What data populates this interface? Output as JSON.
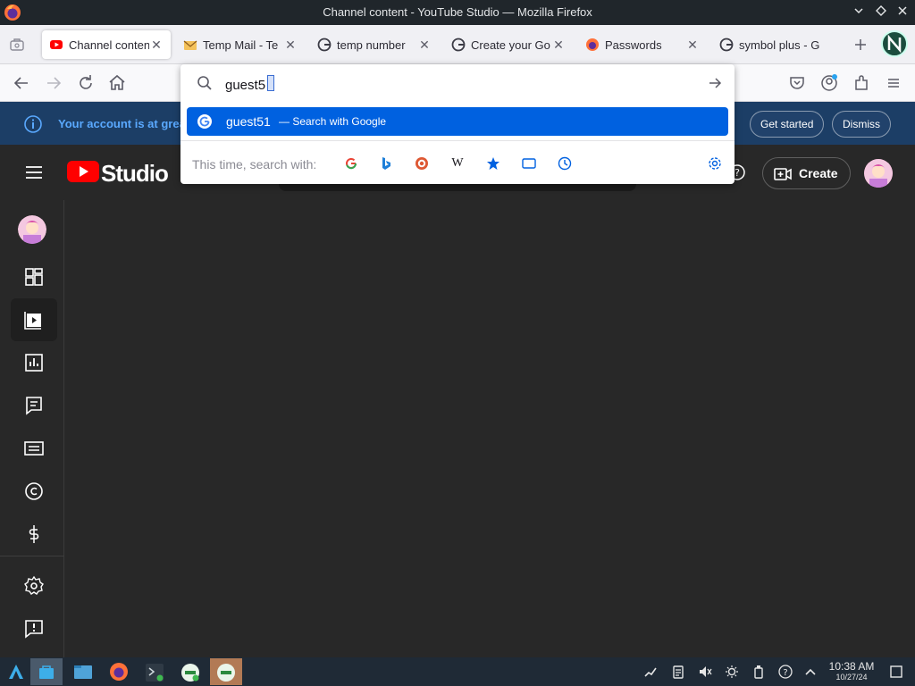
{
  "window": {
    "title": "Channel content - YouTube Studio — Mozilla Firefox",
    "minimize_icon": "chevron-down-icon",
    "maximize_icon": "diamond-icon",
    "close_icon": "close-icon"
  },
  "tabs": [
    {
      "label": "Channel content",
      "favicon": "youtube-icon",
      "active": true
    },
    {
      "label": "Temp Mail - Te",
      "favicon": "mail-icon",
      "active": false
    },
    {
      "label": "temp number",
      "favicon": "google-icon",
      "active": false
    },
    {
      "label": "Create your Go",
      "favicon": "google-icon",
      "active": false
    },
    {
      "label": "Passwords",
      "favicon": "firefox-icon",
      "active": false
    },
    {
      "label": "symbol plus - G",
      "favicon": "google-icon",
      "active": false
    }
  ],
  "urlbar": {
    "value": "guest5",
    "suggestion": {
      "text": "guest51",
      "sub": "— Search with Google"
    },
    "oneoff_label": "This time, search with:",
    "oneoff_engines": [
      "google",
      "bing",
      "duckduckgo",
      "wikipedia",
      "bookmarks",
      "tabs",
      "history"
    ],
    "settings_icon": "gear-icon"
  },
  "banner": {
    "text": "Your account is at great",
    "get_started": "Get started",
    "dismiss": "Dismiss"
  },
  "studio": {
    "logo_text": "Studio",
    "create_label": "Create",
    "sidebar_icons": [
      "dashboard-icon",
      "content-icon",
      "analytics-icon",
      "comments-icon",
      "subtitles-icon",
      "copyright-icon",
      "earn-icon",
      "settings-icon",
      "feedback-icon"
    ],
    "active_item": "content-icon"
  },
  "colors": {
    "accent": "#0061e0",
    "banner": "#1c3e66",
    "banner_text": "#5aa9ff",
    "studio_bg": "#282828",
    "youtube_red": "#ff0000"
  },
  "taskbar": {
    "time": "10:38 AM",
    "date": "10/27/24",
    "apps": [
      "app-launcher-icon",
      "store-icon",
      "files-icon",
      "firefox-icon",
      "terminal-icon",
      "app-icon",
      "app-icon"
    ]
  }
}
